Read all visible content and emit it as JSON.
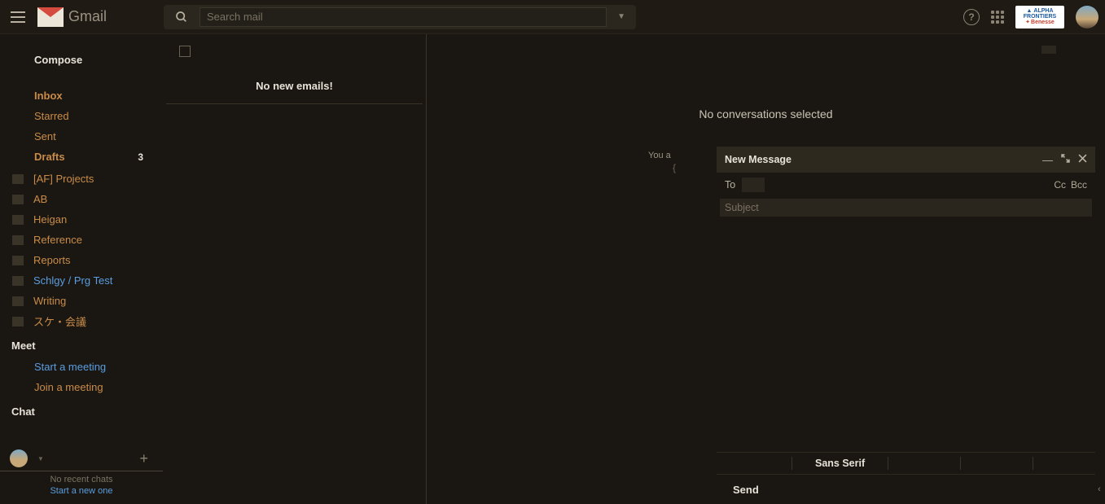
{
  "header": {
    "product": "Gmail",
    "search_placeholder": "Search mail",
    "help_tooltip": "Support",
    "apps_tooltip": "Google apps",
    "org": {
      "line1": "ALPHA",
      "line2": "FRONTIERS",
      "line3": "Benesse"
    }
  },
  "sidebar": {
    "compose": "Compose",
    "nav": [
      {
        "label": "Inbox",
        "bold": true
      },
      {
        "label": "Starred"
      },
      {
        "label": "Sent"
      },
      {
        "label": "Drafts",
        "bold": true,
        "count": "3"
      }
    ],
    "labels": [
      {
        "label": "[AF] Projects"
      },
      {
        "label": "AB"
      },
      {
        "label": "Heigan"
      },
      {
        "label": "Reference"
      },
      {
        "label": "Reports"
      },
      {
        "label": "Schlgy / Prg Test",
        "blue": true
      },
      {
        "label": "Writing"
      },
      {
        "label": "スケ・会議"
      }
    ],
    "meet_header": "Meet",
    "meet_items": [
      {
        "label": "Start a meeting",
        "cls": "blue"
      },
      {
        "label": "Join a meeting",
        "cls": "orange"
      }
    ],
    "chat_header": "Chat",
    "chat_user": "",
    "no_recent": "No recent chats",
    "start_new": "Start a new one"
  },
  "threads": {
    "empty": "No new emails!"
  },
  "reading": {
    "empty": "No conversations selected",
    "truncated_note": "You a",
    "curly": "{"
  },
  "compose_win": {
    "title": "New Message",
    "to_label": "To",
    "cc": "Cc",
    "bcc": "Bcc",
    "subject_placeholder": "Subject",
    "font": "Sans Serif",
    "send": "Send"
  }
}
